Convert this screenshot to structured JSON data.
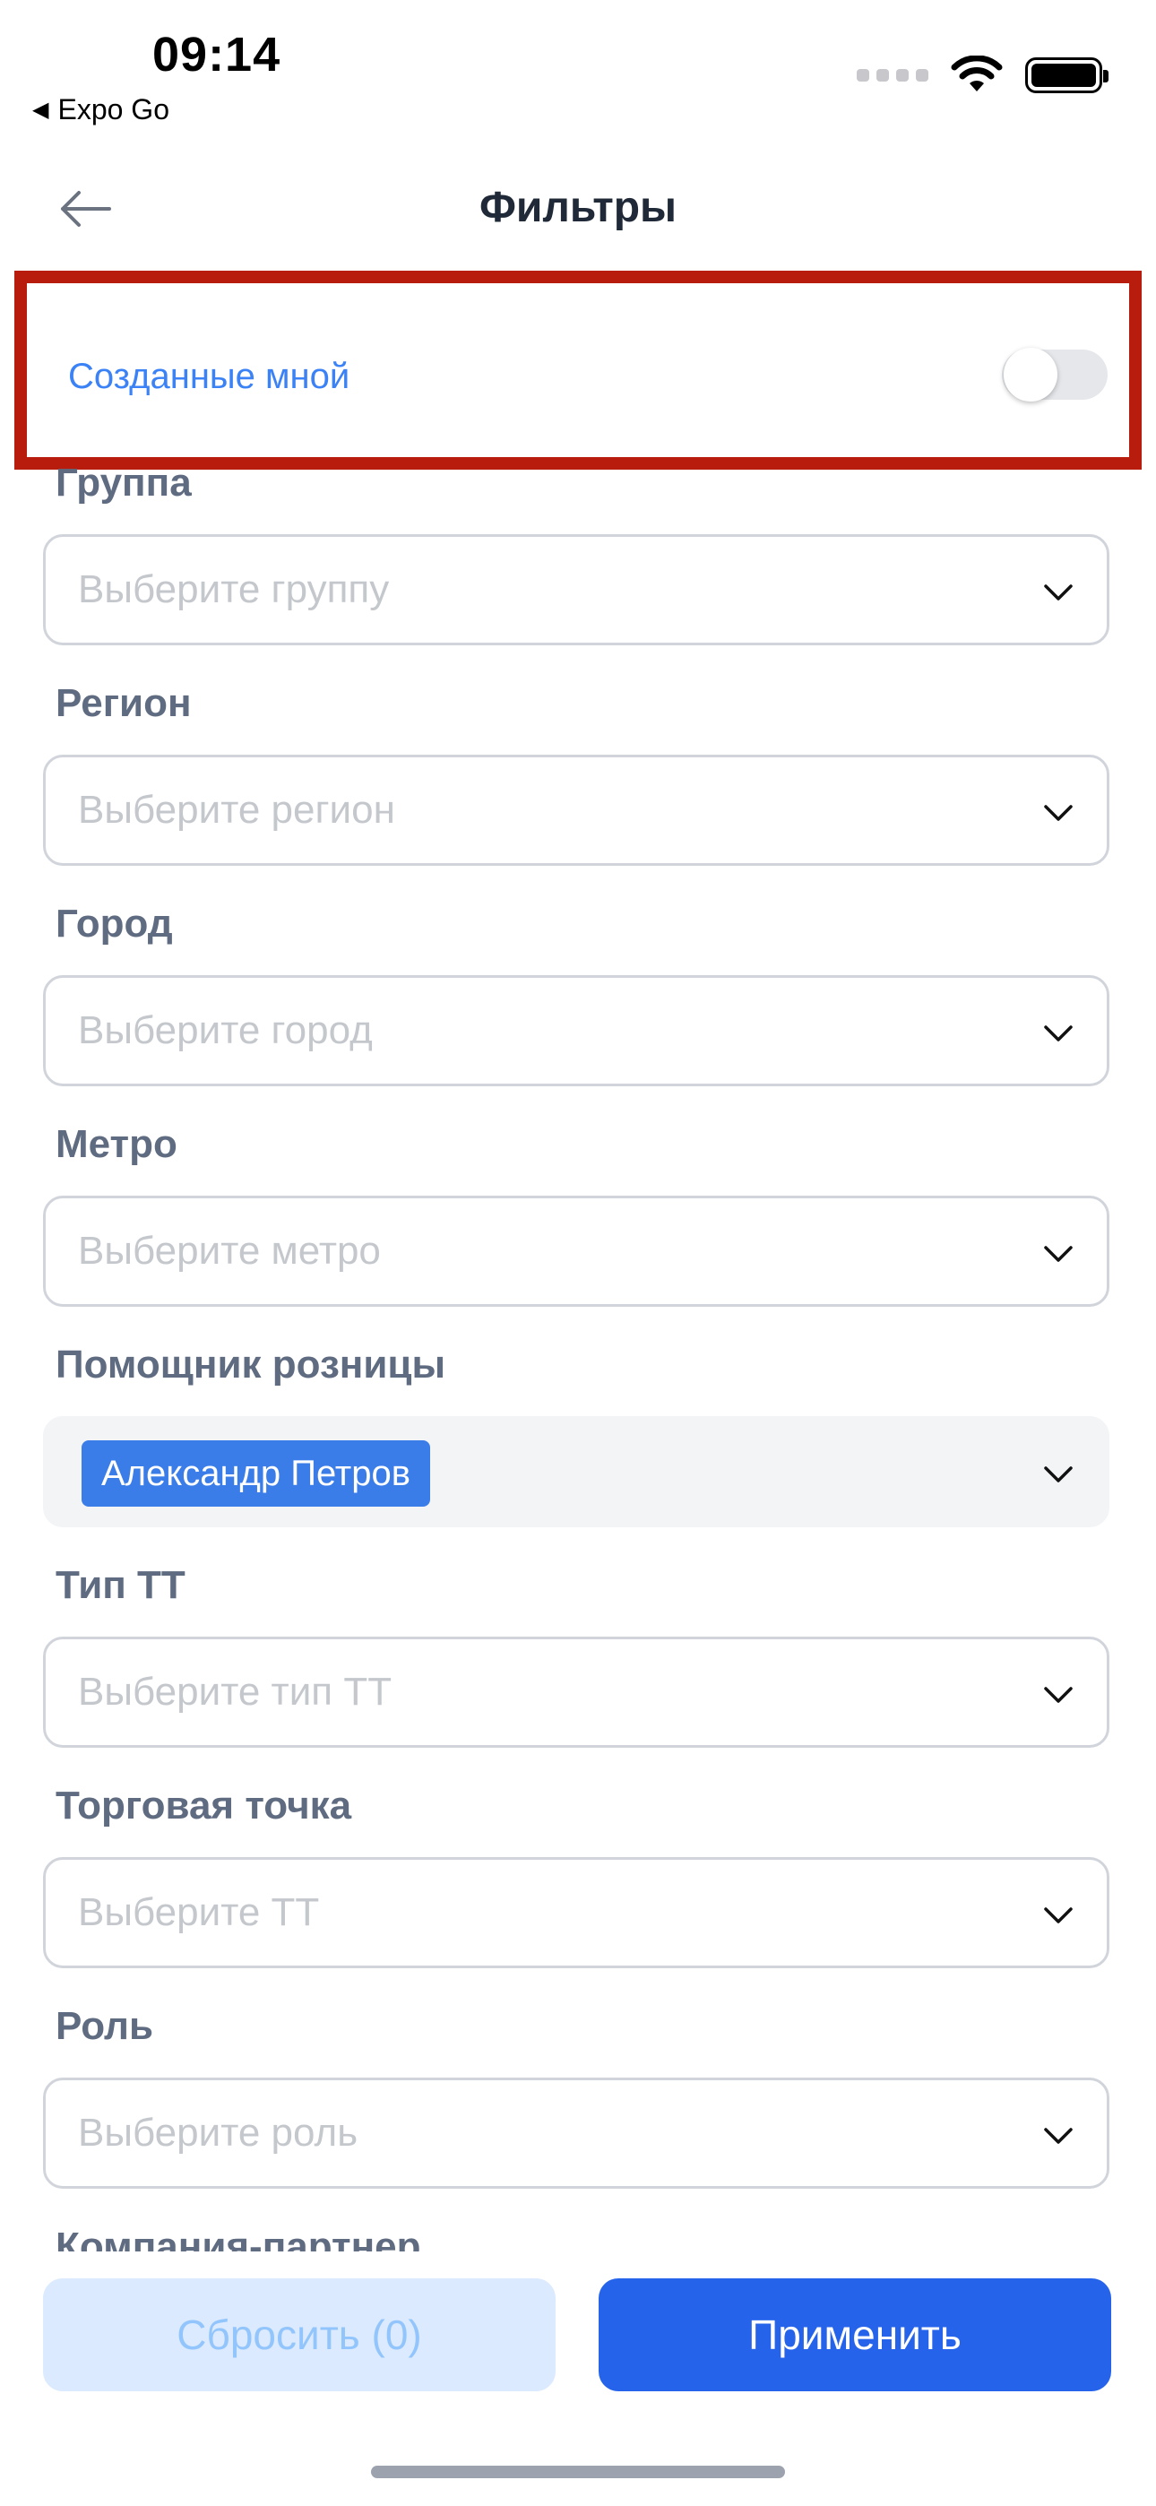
{
  "status_bar": {
    "time": "09:14",
    "back_app": "Expo Go"
  },
  "header": {
    "title": "Фильтры"
  },
  "toggle": {
    "label": "Созданные мной",
    "checked": false
  },
  "fields": [
    {
      "label": "Группа",
      "placeholder": "Выберите группу"
    },
    {
      "label": "Регион",
      "placeholder": "Выберите регион"
    },
    {
      "label": "Город",
      "placeholder": "Выберите город"
    },
    {
      "label": "Метро",
      "placeholder": "Выберите метро"
    },
    {
      "label": "Помощник розницы",
      "selected_chip": "Александр Петров"
    },
    {
      "label": "Тип ТТ",
      "placeholder": "Выберите тип ТТ"
    },
    {
      "label": "Торговая точка",
      "placeholder": "Выберите ТТ"
    },
    {
      "label": "Роль",
      "placeholder": "Выберите роль"
    },
    {
      "label": "Компания-партнер"
    }
  ],
  "buttons": {
    "reset": "Сбросить (0)",
    "apply": "Применить"
  },
  "colors": {
    "accent": "#2563eb",
    "highlight_border": "#b71c0c",
    "label": "#5f6b80",
    "chip": "#3b7de8"
  }
}
